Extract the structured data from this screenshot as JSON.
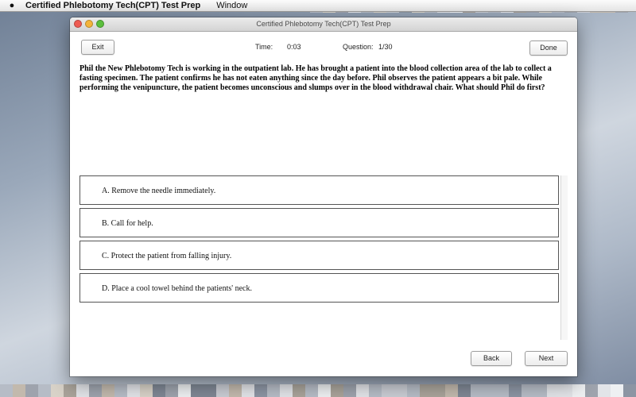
{
  "menubar": {
    "app_name": "Certified Phlebotomy Tech(CPT) Test Prep",
    "menu_window": "Window"
  },
  "window": {
    "title": "Certified Phlebotomy Tech(CPT) Test Prep"
  },
  "toolbar": {
    "exit_label": "Exit",
    "time_label": "Time:",
    "time_value": "0:03",
    "question_label": "Question:",
    "question_value": "1/30",
    "done_label": "Done"
  },
  "question": {
    "text": "Phil the New Phlebotomy Tech is working in the outpatient lab. He has brought a patient into the blood collection area of the lab to collect a fasting specimen. The patient confirms he has not eaten anything since the day before. Phil observes the patient appears a bit pale. While performing the venipuncture, the patient becomes unconscious and slumps over in the blood withdrawal chair. What should Phil do first?"
  },
  "answers": [
    {
      "text": "A. Remove the needle immediately."
    },
    {
      "text": "B. Call for help."
    },
    {
      "text": "C. Protect the patient from falling injury."
    },
    {
      "text": "D. Place a cool towel behind the patients' neck."
    }
  ],
  "nav": {
    "back_label": "Back",
    "next_label": "Next"
  },
  "colors": {
    "close": "#ee5b52",
    "minimize": "#f4b43a",
    "zoom": "#5bbf3d"
  }
}
